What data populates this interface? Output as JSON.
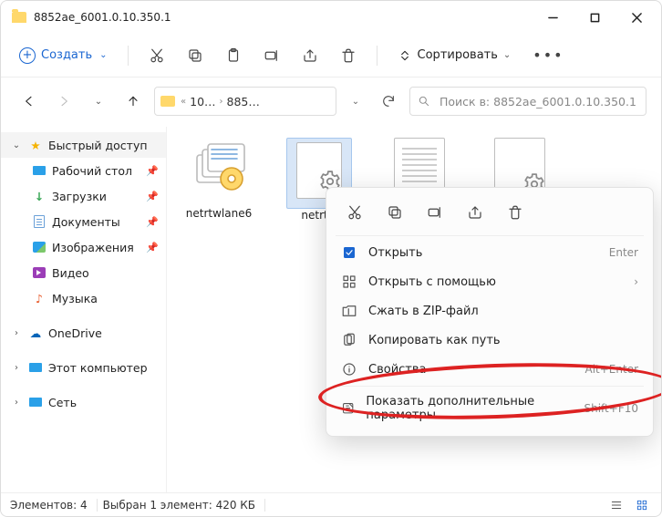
{
  "window": {
    "title": "8852ae_6001.0.10.350.1"
  },
  "toolbar": {
    "new_label": "Создать",
    "sort_label": "Сортировать"
  },
  "breadcrumb": {
    "crumb1": "10…",
    "crumb2": "885…"
  },
  "search": {
    "placeholder": "Поиск в: 8852ae_6001.0.10.350.1"
  },
  "sidebar": {
    "quick": "Быстрый доступ",
    "desktop": "Рабочий стол",
    "downloads": "Загрузки",
    "documents": "Документы",
    "pictures": "Изображения",
    "video": "Видео",
    "music": "Музыка",
    "onedrive": "OneDrive",
    "thispc": "Этот компьютер",
    "network": "Сеть"
  },
  "files": {
    "f1": "netrtwlane6",
    "f2": "netrtw"
  },
  "context": {
    "open": "Открыть",
    "open_hint": "Enter",
    "openwith": "Открыть с помощью",
    "zip": "Сжать в ZIP-файл",
    "copypath": "Копировать как путь",
    "properties": "Свойства",
    "properties_hint": "Alt+Enter",
    "moreoptions": "Показать дополнительные параметры",
    "moreoptions_hint": "Shift+F10"
  },
  "status": {
    "count": "Элементов: 4",
    "selection": "Выбран 1 элемент: 420 КБ"
  }
}
